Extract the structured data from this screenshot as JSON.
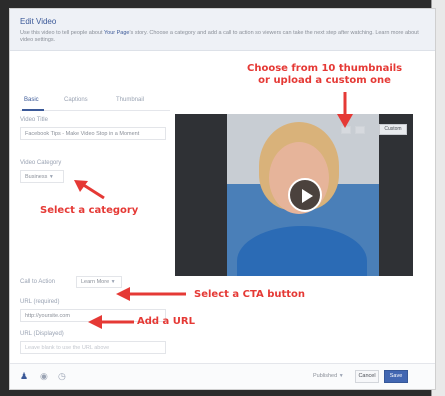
{
  "dialog": {
    "title": "Edit Video",
    "intro_prefix": "Use this video to tell people about ",
    "page_name": "Your Page",
    "intro_suffix": "'s story. Choose a category and add a call to action so viewers can take the next step after watching. Learn more about video settings.",
    "tabs": [
      {
        "label": "Basic",
        "active": true
      },
      {
        "label": "Captions",
        "active": false
      },
      {
        "label": "Thumbnail",
        "active": false
      }
    ]
  },
  "form": {
    "title_label": "Video Title",
    "title_value": "Facebook Tips - Make Video Stop in a Moment",
    "category_label": "Video Category",
    "category_value": "Business",
    "cta_label": "Call to Action",
    "cta_value": "Learn More",
    "url_label": "URL (required)",
    "url_value": "http://yoursite.com",
    "display_label": "URL (Displayed)",
    "display_placeholder": "Leave blank to use the URL above"
  },
  "video": {
    "custom_button_label": "Custom"
  },
  "annotations": {
    "thumbnails_line1": "Choose from 10 thumbnails",
    "thumbnails_line2": "or upload a custom one",
    "category": "Select a category",
    "cta": "Select a CTA button",
    "url": "Add a URL"
  },
  "footer": {
    "publish_label": "Published",
    "cancel_label": "Cancel",
    "save_label": "Save"
  },
  "colors": {
    "brand": "#3b5998",
    "annotation": "#e53935",
    "save_button": "#4267b2"
  },
  "icons": [
    "chevron-down-icon",
    "play-icon",
    "person-icon",
    "location-icon",
    "clock-icon"
  ]
}
